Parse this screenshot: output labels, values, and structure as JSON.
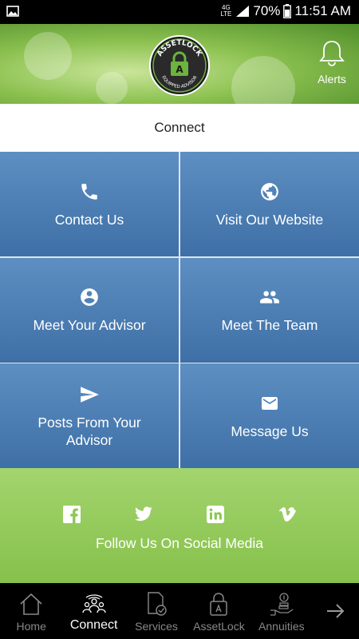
{
  "status_bar": {
    "network_type": "4G LTE",
    "battery": "70%",
    "time": "11:51 AM"
  },
  "header": {
    "logo_top_text": "ASSETLOCK",
    "logo_bottom_text": "EQUIPPED ADVISOR",
    "logo_letter": "A",
    "alerts_label": "Alerts"
  },
  "page_title": "Connect",
  "tiles": [
    {
      "label": "Contact Us",
      "icon": "phone-icon"
    },
    {
      "label": "Visit Our Website",
      "icon": "globe-icon"
    },
    {
      "label": "Meet Your Advisor",
      "icon": "user-circle-icon"
    },
    {
      "label": "Meet The Team",
      "icon": "group-icon"
    },
    {
      "label": "Posts From Your Advisor",
      "icon": "send-icon"
    },
    {
      "label": "Message Us",
      "icon": "envelope-icon"
    }
  ],
  "social": {
    "label": "Follow Us On Social Media",
    "icons": [
      "facebook-icon",
      "twitter-icon",
      "linkedin-icon",
      "vimeo-icon"
    ]
  },
  "bottom_nav": {
    "items": [
      {
        "label": "Home",
        "icon": "home-icon"
      },
      {
        "label": "Connect",
        "icon": "connect-icon",
        "active": true
      },
      {
        "label": "Services",
        "icon": "services-icon"
      },
      {
        "label": "AssetLock",
        "icon": "lock-icon"
      },
      {
        "label": "Annuities",
        "icon": "annuities-icon"
      }
    ],
    "next_icon": "arrow-right-icon"
  },
  "colors": {
    "tile_top": "#5d8fc2",
    "tile_bottom": "#3e6fa6",
    "social_green": "#8cc751",
    "header_green": "#8cc150"
  }
}
